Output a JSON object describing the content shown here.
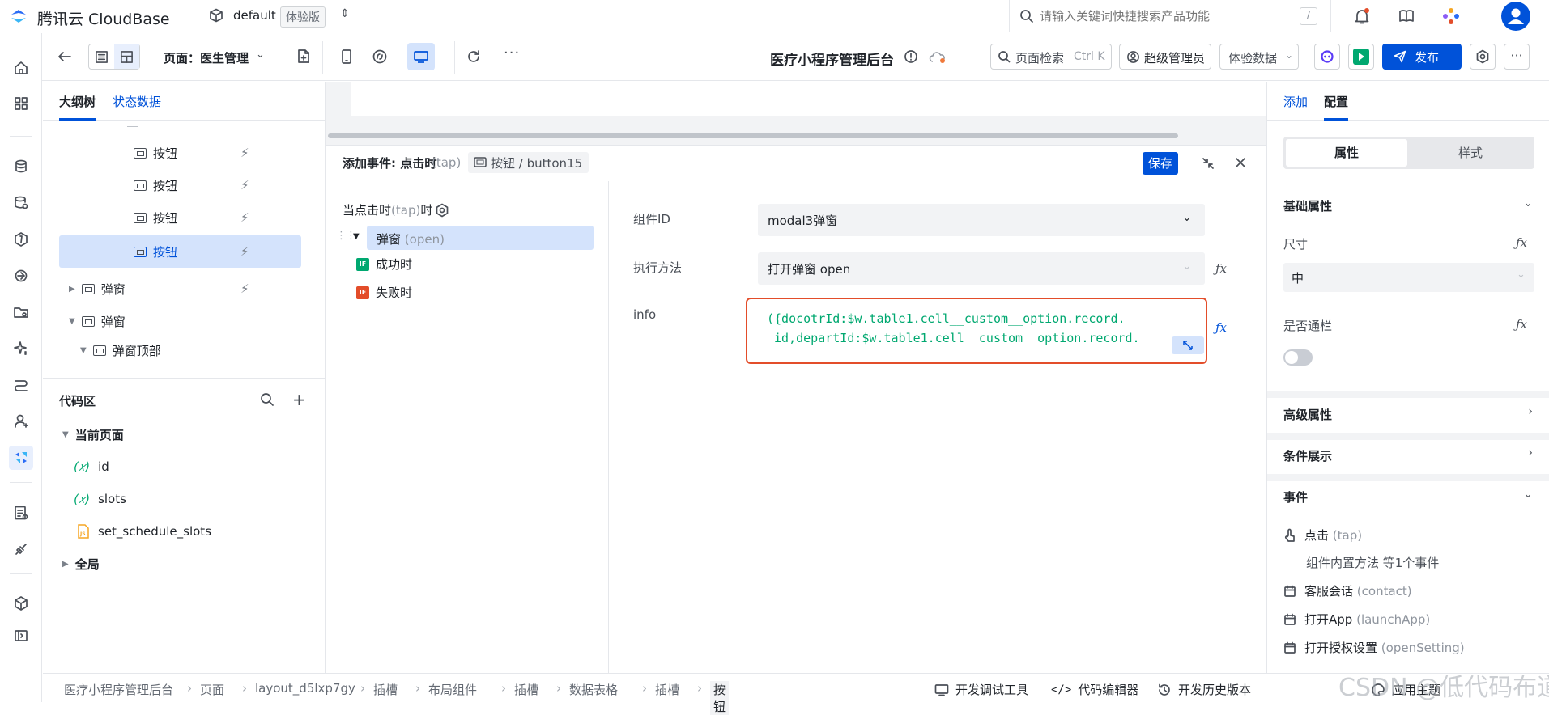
{
  "topbar": {
    "brand": "腾讯云 CloudBase",
    "env": "default",
    "env_badge": "体验版",
    "search_placeholder": "请输入关键词快捷搜索产品功能",
    "search_shortcut": "/"
  },
  "toolbar": {
    "page_label": "页面：医生管理",
    "app_title": "医疗小程序管理后台",
    "page_search": "页面检索",
    "page_search_key": "Ctrl K",
    "role": "超级管理员",
    "data_mode": "体验数据",
    "publish": "发布"
  },
  "left": {
    "tab_outline": "大纲树",
    "tab_state": "状态数据",
    "tree": [
      {
        "label": "按钮"
      },
      {
        "label": "按钮"
      },
      {
        "label": "按钮"
      },
      {
        "label": "按钮",
        "selected": true
      },
      {
        "label": "弹窗"
      },
      {
        "label": "弹窗"
      },
      {
        "label": "弹窗顶部"
      }
    ],
    "code_title": "代码区",
    "current_page": "当前页面",
    "vars": [
      {
        "prefix": "(𝑥)",
        "name": "id"
      },
      {
        "prefix": "(𝑥)",
        "name": "slots"
      }
    ],
    "func": "set_schedule_slots",
    "global": "全局"
  },
  "event": {
    "title": "添加事件: 点击时",
    "title_hint": "(tap)",
    "target": "按钮 / button15",
    "save": "保存",
    "trigger": "当点击时",
    "trigger_hint": "(tap)",
    "trigger_suffix": "时",
    "action": "弹窗",
    "action_hint": "(open)",
    "success": "成功时",
    "fail": "失败时",
    "field_component_label": "组件ID",
    "field_component_value": "modal3弹窗",
    "field_method_label": "执行方法",
    "field_method_value": "打开弹窗 open",
    "field_info_label": "info",
    "code_line1": "({docotrId:$w.table1.cell__custom__option.record.",
    "code_line2": "_id,departId:$w.table1.cell__custom__option.record."
  },
  "right": {
    "tab_add": "添加",
    "tab_config": "配置",
    "seg_props": "属性",
    "seg_style": "样式",
    "basic": "基础属性",
    "size_label": "尺寸",
    "size_value": "中",
    "banner_label": "是否通栏",
    "advanced": "高级属性",
    "conditional": "条件展示",
    "events": "事件",
    "event_items": [
      {
        "label": "点击",
        "hint": "(tap)"
      },
      {
        "label": "组件内置方法 等1个事件",
        "hint": ""
      },
      {
        "label": "客服会话",
        "hint": "(contact)"
      },
      {
        "label": "打开App",
        "hint": "(launchApp)"
      },
      {
        "label": "打开授权设置",
        "hint": "(openSetting)"
      }
    ]
  },
  "bottom": {
    "crumbs": [
      "医疗小程序管理后台",
      "页面",
      "layout_d5lxp7gy",
      "插槽",
      "布局组件",
      "插槽",
      "数据表格",
      "插槽",
      "按钮"
    ],
    "dev_tools": "开发调试工具",
    "code_editor": "代码编辑器",
    "history": "开发历史版本",
    "theme": "应用主题",
    "watermark": "CSDN @低代码布道师"
  },
  "colors": {
    "primary": "#0052d9",
    "green": "#00a870",
    "red_border": "#e34d2a",
    "selected_bg": "#d4e3fc"
  }
}
